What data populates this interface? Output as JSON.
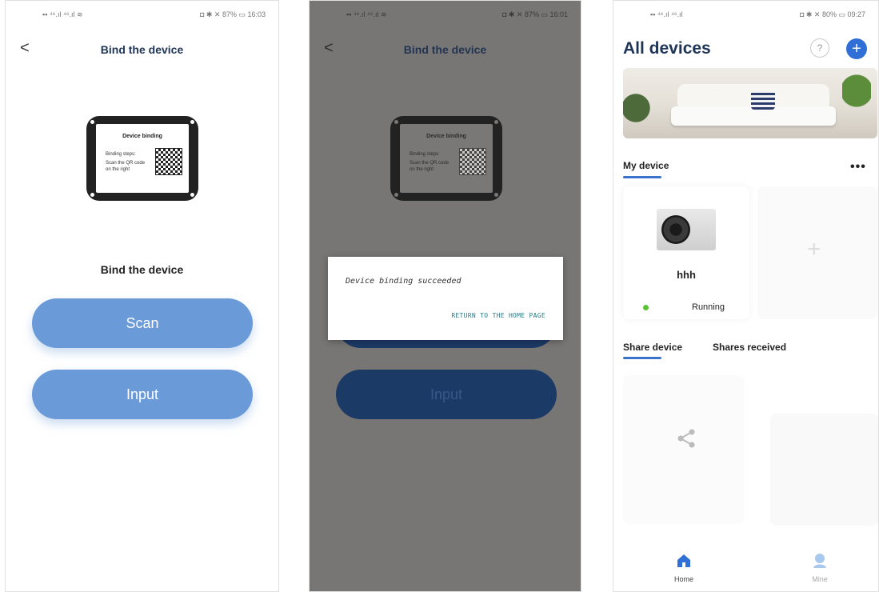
{
  "screen1": {
    "status_left": "▪▪ ⁴⁶.ıl ⁴⁶.ıl ≋",
    "status_right": "◘ ✱ ✕ 87% ▭ 16:03",
    "header_title": "Bind the device",
    "back_glyph": "<",
    "device_binding_title": "Device binding",
    "binding_steps": "Binding steps:",
    "binding_instruction": "Scan the QR code on the right",
    "bind_label": "Bind the device",
    "scan_button": "Scan",
    "input_button": "Input"
  },
  "screen2": {
    "status_left": "▪▪ ⁴⁶.ıl ⁴⁶.ıl ≋",
    "status_right": "◘ ✱ ✕ 87% ▭ 16:01",
    "header_title": "Bind the device",
    "back_glyph": "<",
    "device_binding_title": "Device binding",
    "binding_steps": "Binding steps:",
    "binding_instruction": "Scan the QR code on the right",
    "dialog_message": "Device binding succeeded",
    "dialog_action": "RETURN TO THE HOME PAGE",
    "input_button": "Input",
    "overlay_color": "#787674"
  },
  "screen3": {
    "status_left": "▪▪ ⁴⁶.ıl ⁴⁶.ıl",
    "status_right": "◘ ✱ ✕ 80% ▭ 09:27",
    "page_title": "All devices",
    "help_icon_glyph": "?",
    "add_icon_glyph": "+",
    "my_device_tab": "My device",
    "more_glyph": "•••",
    "device_name": "hhh",
    "device_status": "Running",
    "add_card_glyph": "+",
    "share_device_tab": "Share device",
    "shares_received_tab": "Shares received",
    "tabs": [
      {
        "label": "Home",
        "icon": "home-icon"
      },
      {
        "label": "Mine",
        "icon": "person-icon"
      }
    ],
    "accent_color": "#2f6fd6",
    "status_color": "#5bc236"
  }
}
